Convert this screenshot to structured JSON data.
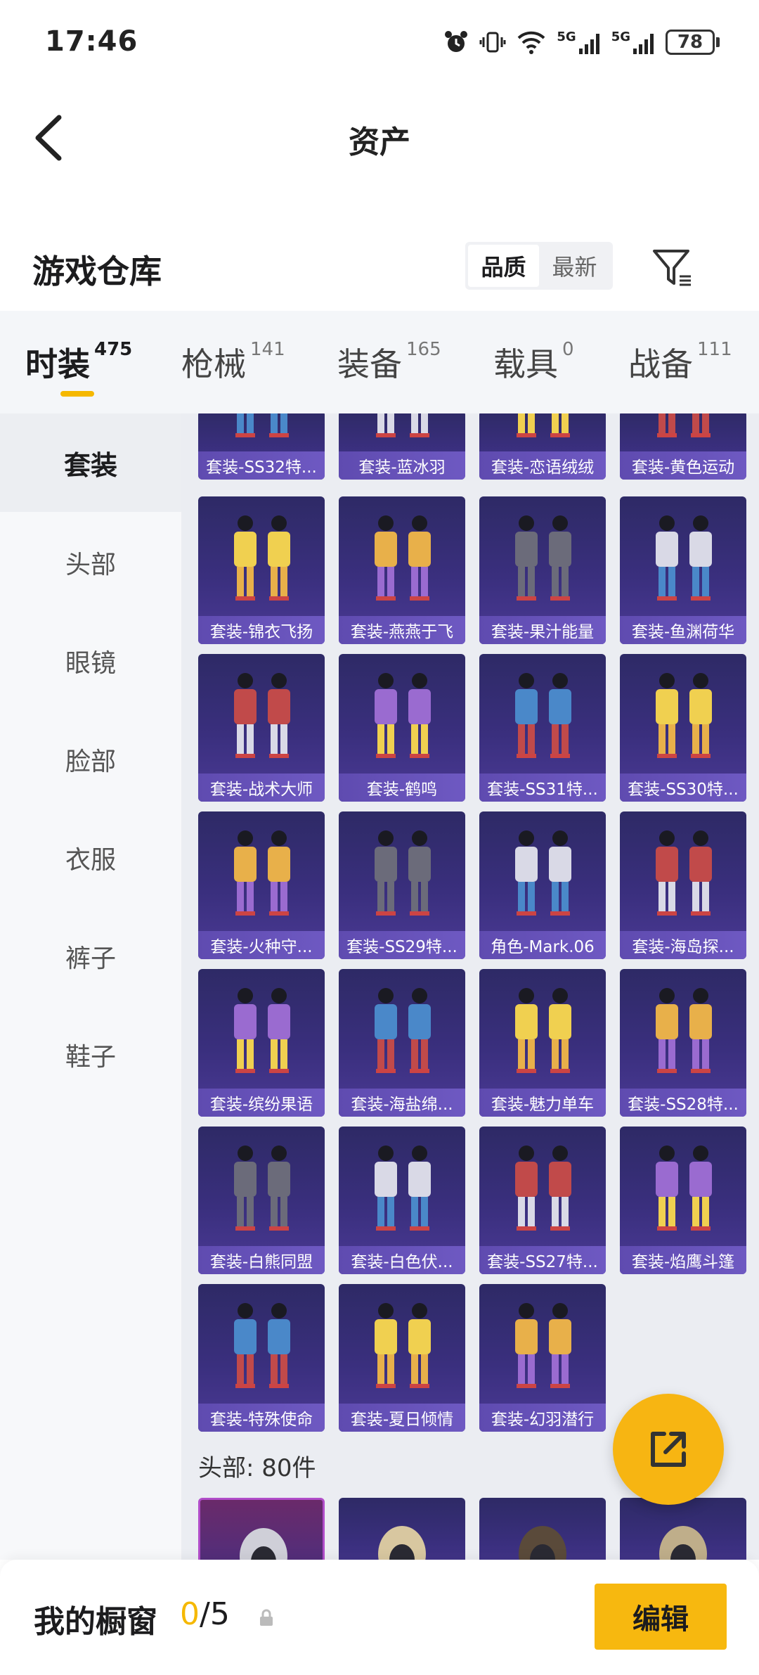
{
  "status_bar": {
    "time": "17:46",
    "battery": "78",
    "signal1": "5G",
    "signal2": "5G"
  },
  "nav": {
    "title": "资产",
    "back_icon": "chevron-left-icon"
  },
  "warehouse": {
    "title": "游戏仓库",
    "sort_options": [
      "品质",
      "最新"
    ],
    "active_sort": "品质",
    "filter_icon": "filter-icon"
  },
  "category_tabs": [
    {
      "label": "时装",
      "count": "475",
      "active": true
    },
    {
      "label": "枪械",
      "count": "141"
    },
    {
      "label": "装备",
      "count": "165"
    },
    {
      "label": "载具",
      "count": "0"
    },
    {
      "label": "战备",
      "count": "111"
    }
  ],
  "sidebar": {
    "items": [
      {
        "label": "套装",
        "active": true
      },
      {
        "label": "头部"
      },
      {
        "label": "眼镜"
      },
      {
        "label": "脸部"
      },
      {
        "label": "衣服"
      },
      {
        "label": "裤子"
      },
      {
        "label": "鞋子"
      }
    ]
  },
  "grid": {
    "items": [
      {
        "label": "套装-SS32特..."
      },
      {
        "label": "套装-蓝冰羽"
      },
      {
        "label": "套装-恋语绒绒"
      },
      {
        "label": "套装-黄色运动"
      },
      {
        "label": "套装-锦衣飞扬"
      },
      {
        "label": "套装-燕燕于飞"
      },
      {
        "label": "套装-果汁能量"
      },
      {
        "label": "套装-鱼渊荷华"
      },
      {
        "label": "套装-战术大师"
      },
      {
        "label": "套装-鹤鸣"
      },
      {
        "label": "套装-SS31特..."
      },
      {
        "label": "套装-SS30特..."
      },
      {
        "label": "套装-火种守..."
      },
      {
        "label": "套装-SS29特..."
      },
      {
        "label": "角色-Mark.06"
      },
      {
        "label": "套装-海岛探..."
      },
      {
        "label": "套装-缤纷果语"
      },
      {
        "label": "套装-海盐绵..."
      },
      {
        "label": "套装-魅力单车"
      },
      {
        "label": "套装-SS28特..."
      },
      {
        "label": "套装-白熊同盟"
      },
      {
        "label": "套装-白色伏..."
      },
      {
        "label": "套装-SS27特..."
      },
      {
        "label": "套装-焰鹰斗篷"
      },
      {
        "label": "套装-特殊使命"
      },
      {
        "label": "套装-夏日倾情"
      },
      {
        "label": "套装-幻羽潜行"
      }
    ],
    "section_label": "头部: 80件"
  },
  "fab": {
    "icon": "share-external-icon"
  },
  "showcase": {
    "title": "我的橱窗",
    "current": "0",
    "total": "/5",
    "lock_icon": "lock-icon",
    "edit_label": "编辑"
  },
  "colors": {
    "accent": "#f7b80f",
    "card_bg": "#3a2f7e",
    "label_bg": "#6a55bd"
  }
}
